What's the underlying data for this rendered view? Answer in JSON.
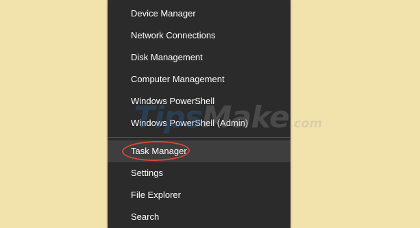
{
  "menu": {
    "items": [
      {
        "label": "Device Manager"
      },
      {
        "label": "Network Connections"
      },
      {
        "label": "Disk Management"
      },
      {
        "label": "Computer Management"
      },
      {
        "label": "Windows PowerShell"
      },
      {
        "label": "Windows PowerShell (Admin)"
      },
      {
        "label": "Task Manager"
      },
      {
        "label": "Settings"
      },
      {
        "label": "File Explorer"
      },
      {
        "label": "Search"
      }
    ]
  },
  "watermark": {
    "main": "Tips",
    "accent": "Make",
    "domain": ".com"
  },
  "colors": {
    "background": "#f2e3ad",
    "menu_background": "#2b2b2b",
    "menu_hover": "#3e3e3e",
    "menu_text": "#ffffff",
    "annotation": "#d8433c"
  }
}
